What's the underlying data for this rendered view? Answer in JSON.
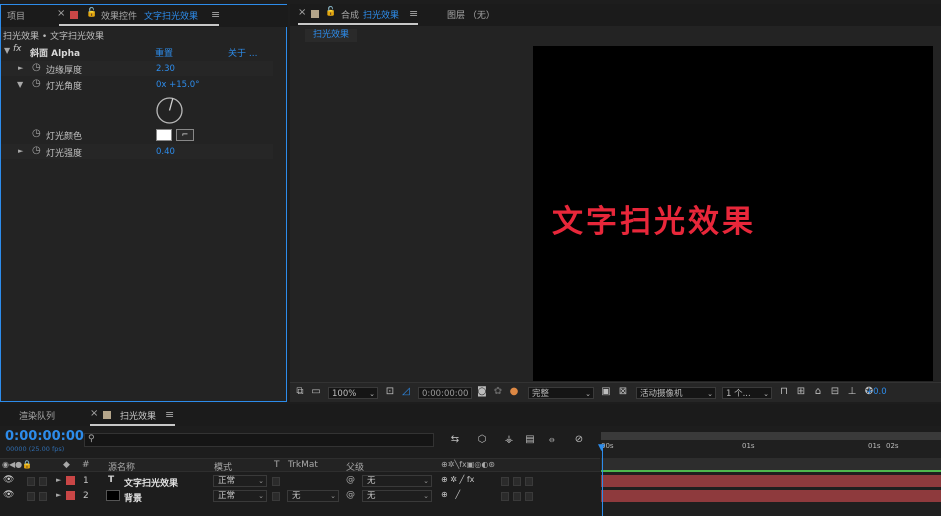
{
  "left_panel": {
    "tab_project": "项目",
    "tab_effect_controls": "效果控件",
    "tab_effect_layer": "文字扫光效果",
    "menu_icon": "≡",
    "breadcrumb": "扫光效果 • 文字扫光效果",
    "effect": {
      "name": "斜面 Alpha",
      "reset": "重置",
      "about": "关于 ...",
      "properties": [
        {
          "label": "边缘厚度",
          "value": "2.30",
          "expanded": false
        },
        {
          "label": "灯光角度",
          "value": "0x +15.0°",
          "expanded": true
        },
        {
          "label": "灯光颜色",
          "value": ""
        },
        {
          "label": "灯光强度",
          "value": "0.40",
          "expanded": false
        }
      ],
      "light_color": "#ffffff"
    }
  },
  "comp_panel": {
    "tab_prefix": "合成",
    "tab_name": "扫光效果",
    "menu_icon": "≡",
    "layer_tab": "图层 （无）",
    "subtab": "扫光效果",
    "viewer_text": "文字扫光效果",
    "viewer_text_color": "#e8273a",
    "toolbar": {
      "zoom": "100%",
      "timecode": "0:00:00:00",
      "resolution": "完整",
      "camera": "活动摄像机",
      "views": "1 个...",
      "exposure": "+0.0"
    }
  },
  "timeline": {
    "tab_render_queue": "渲染队列",
    "tab_comp": "扫光效果",
    "menu_icon": "≡",
    "timecode": "0:00:00:00",
    "timecode_sub": "00000 (25.00 fps)",
    "search_placeholder": "",
    "headers": {
      "num": "#",
      "source_name": "源名称",
      "mode": "模式",
      "t": "T",
      "trkmat": "TrkMat",
      "parent": "父级"
    },
    "ruler": [
      "00s",
      "01s",
      "01s",
      "02s"
    ],
    "layers": [
      {
        "num": "1",
        "type_icon": "T",
        "name": "文字扫光效果",
        "mode": "正常",
        "trkmat": "",
        "parent": "无",
        "label_color": "#c94646",
        "thumb_color": ""
      },
      {
        "num": "2",
        "type_icon": "",
        "name": "背景",
        "mode": "正常",
        "trkmat": "无",
        "parent": "无",
        "label_color": "#c94646",
        "thumb_color": "#000000"
      }
    ],
    "bar_color": "#8e3a3d"
  }
}
